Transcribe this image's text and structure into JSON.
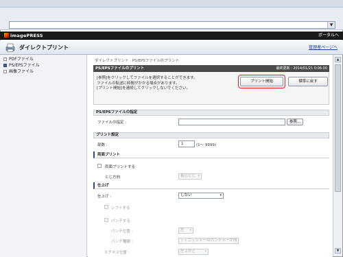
{
  "browser": {
    "address_value": "",
    "dropdown_glyph": "▼"
  },
  "header": {
    "logo_text": "imagePRESS",
    "portal_link": "ポータルへ"
  },
  "title_band": {
    "app_title": "ダイレクトプリント",
    "admin_link": "管理者ページへ"
  },
  "sidebar": {
    "items": [
      {
        "label": "PDFファイル",
        "active": false
      },
      {
        "label": "PS/EPSファイル",
        "active": true
      },
      {
        "label": "画像ファイル",
        "active": false
      }
    ]
  },
  "main": {
    "breadcrumb": "ダイレクトプリント : PS/EPSファイルのプリント",
    "modal": {
      "title": "PS/EPSファイルのプリント",
      "date": "最終更新 : 2014/01/21 0:06:00",
      "message_lines": [
        "[参照]をクリックしてファイルを選択することができます。",
        "ファイルの転送に時間がかかる場合があります。",
        "[プリント開始]を連続してクリックしないでください。"
      ],
      "print_button": "プリント開始",
      "back_button": "標準に戻す"
    },
    "file_section": {
      "heading": "PS/EPSファイルの指定",
      "file_label": "ファイルの指定 :",
      "browse_button": "参照..."
    },
    "print_settings": {
      "heading": "プリント設定",
      "copies_label": "部数 :",
      "copies_value": "1",
      "copies_range": "(1〜 9999)"
    },
    "duplex": {
      "heading": "両面プリント",
      "checkbox_label": "両面プリントする",
      "binding_label": "とじ方向",
      "binding_value": "長辺とじ"
    },
    "finishing": {
      "heading": "仕上げ",
      "finish_label": "仕上げ :",
      "finish_value": "しない",
      "shift_label": "シフトする",
      "punch_label": "パンチする",
      "punch_position_label": "パンチ位置 :",
      "punch_position_value": "左",
      "punch_type_label": "パンチ種類 :",
      "punch_type_value": "ディニッシャーのパンチャーが内",
      "staple_label": "ホチキス位置 :",
      "staple_value": "左上かど"
    }
  }
}
